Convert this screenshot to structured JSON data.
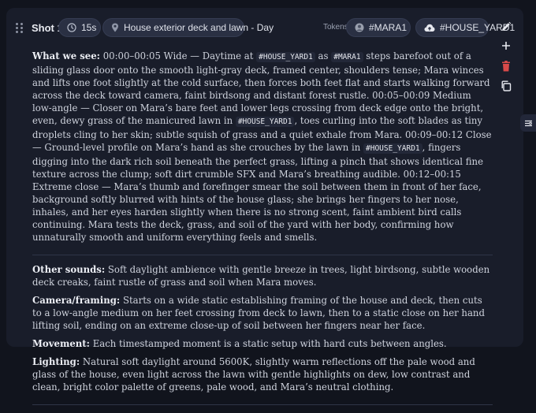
{
  "shot": {
    "label": "Shot 1",
    "duration": "15s",
    "location": "House exterior deck and lawn - Day",
    "tokens_label": "Tokens:",
    "tokens": [
      "#MARA1",
      "#HOUSE_YARD1"
    ]
  },
  "colors": {
    "background": "#11141d",
    "card": "#191d2a",
    "pill": "#2a3043",
    "delete_icon": "#d94a4a",
    "text": "#cfd3dd"
  },
  "icons": {
    "drag": "drag-handle-icon",
    "duration": "clock-icon",
    "location": "map-pin-icon",
    "token_mara": "person-token-icon",
    "token_yard": "cloud-upload-icon",
    "edit": "pencil-icon",
    "add": "plus-icon",
    "delete": "trash-icon",
    "copy": "copy-icon",
    "floating": "settings-toggle-icon"
  },
  "what_we_see": {
    "label": "What we see:",
    "segments": [
      " 00:00–00:05 Wide — Daytime at ",
      "#HOUSE_YARD1",
      " as ",
      "#MARA1",
      " steps barefoot out of a sliding glass door onto the smooth light-gray deck, framed center, shoulders tense; Mara winces and lifts one foot slightly at the cold surface, then forces both feet flat and starts walking forward across the deck toward camera, faint birdsong and distant forest rustle. 00:05–00:09 Medium low-angle — Closer on Mara’s bare feet and lower legs crossing from deck edge onto the bright, even, dewy grass of the manicured lawn in ",
      "#HOUSE_YARD1",
      ", toes curling into the soft blades as tiny droplets cling to her skin; subtle squish of grass and a quiet exhale from Mara. 00:09–00:12 Close — Ground-level profile on Mara’s hand as she crouches by the lawn in ",
      "#HOUSE_YARD1",
      ", fingers digging into the dark rich soil beneath the perfect grass, lifting a pinch that shows identical fine texture across the clump; soft dirt crumble SFX and Mara’s breathing audible. 00:12–00:15 Extreme close — Mara’s thumb and forefinger smear the soil between them in front of her face, background softly blurred with hints of the house glass; she brings her fingers to her nose, inhales, and her eyes harden slightly when there is no strong scent, faint ambient bird calls continuing. Mara tests the deck, grass, and soil of the yard with her body, confirming how unnaturally smooth and uniform everything feels and smells."
    ]
  },
  "other_sounds": {
    "label": "Other sounds:",
    "text": " Soft daylight ambience with gentle breeze in trees, light birdsong, subtle wooden deck creaks, faint rustle of grass and soil when Mara moves."
  },
  "camera": {
    "label": "Camera/framing:",
    "text": " Starts on a wide static establishing framing of the house and deck, then cuts to a low-angle medium on her feet crossing from deck to lawn, then to a static close on her hand lifting soil, ending on an extreme close-up of soil between her fingers near her face."
  },
  "movement": {
    "label": "Movement:",
    "text": " Each timestamped moment is a static setup with hard cuts between angles."
  },
  "lighting": {
    "label": "Lighting:",
    "text": " Natural soft daylight around 5600K, slightly warm reflections off the pale wood and glass of the house, even light across the lawn with gentle highlights on dew, low contrast and clean, bright color palette of greens, pale wood, and Mara’s neutral clothing."
  }
}
